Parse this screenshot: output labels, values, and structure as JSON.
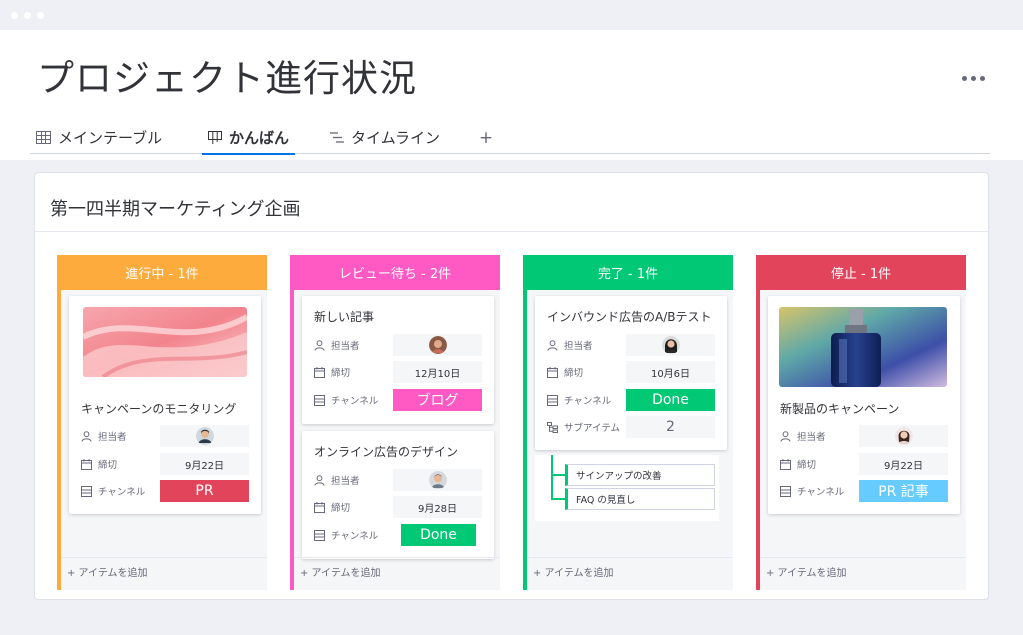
{
  "colors": {
    "accent": "#0073ea",
    "in_progress": "#fdab3d",
    "review": "#ff5ac4",
    "done": "#00c875",
    "stuck": "#e2445c",
    "pr_article": "#66ccff"
  },
  "header": {
    "title": "プロジェクト進行状況"
  },
  "tabs": [
    {
      "label": "メインテーブル",
      "icon": "table-icon"
    },
    {
      "label": "かんばん",
      "icon": "kanban-icon",
      "active": true
    },
    {
      "label": "タイムライン",
      "icon": "timeline-icon"
    }
  ],
  "tab_add_label": "+",
  "board": {
    "title": "第一四半期マーケティング企画",
    "add_item_label": "+ アイテムを追加",
    "columns": [
      {
        "header": "進行中 - 1件",
        "cards": [
          {
            "title": "キャンペーンのモニタリング",
            "owner_label": "担当者",
            "deadline_label": "締切",
            "deadline": "9月22日",
            "channel_label": "チャンネル",
            "channel": "PR"
          }
        ]
      },
      {
        "header": "レビュー待ち - 2件",
        "cards": [
          {
            "title": "新しい記事",
            "owner_label": "担当者",
            "deadline_label": "締切",
            "deadline": "12月10日",
            "channel_label": "チャンネル",
            "channel": "ブログ"
          },
          {
            "title": "オンライン広告のデザイン",
            "owner_label": "担当者",
            "deadline_label": "締切",
            "deadline": "9月28日",
            "channel_label": "チャンネル",
            "channel": "Done"
          }
        ]
      },
      {
        "header": "完了 - 1件",
        "cards": [
          {
            "title": "インバウンド広告のA/Bテスト",
            "owner_label": "担当者",
            "deadline_label": "締切",
            "deadline": "10月6日",
            "channel_label": "チャンネル",
            "channel": "Done",
            "subitems_label": "サブアイテム",
            "subitems_count": "2",
            "subitems": [
              "サインアップの改善",
              "FAQ の見直し"
            ]
          }
        ]
      },
      {
        "header": "停止 - 1件",
        "cards": [
          {
            "title": "新製品のキャンペーン",
            "owner_label": "担当者",
            "deadline_label": "締切",
            "deadline": "9月22日",
            "channel_label": "チャンネル",
            "channel": "PR 記事"
          }
        ]
      }
    ]
  }
}
